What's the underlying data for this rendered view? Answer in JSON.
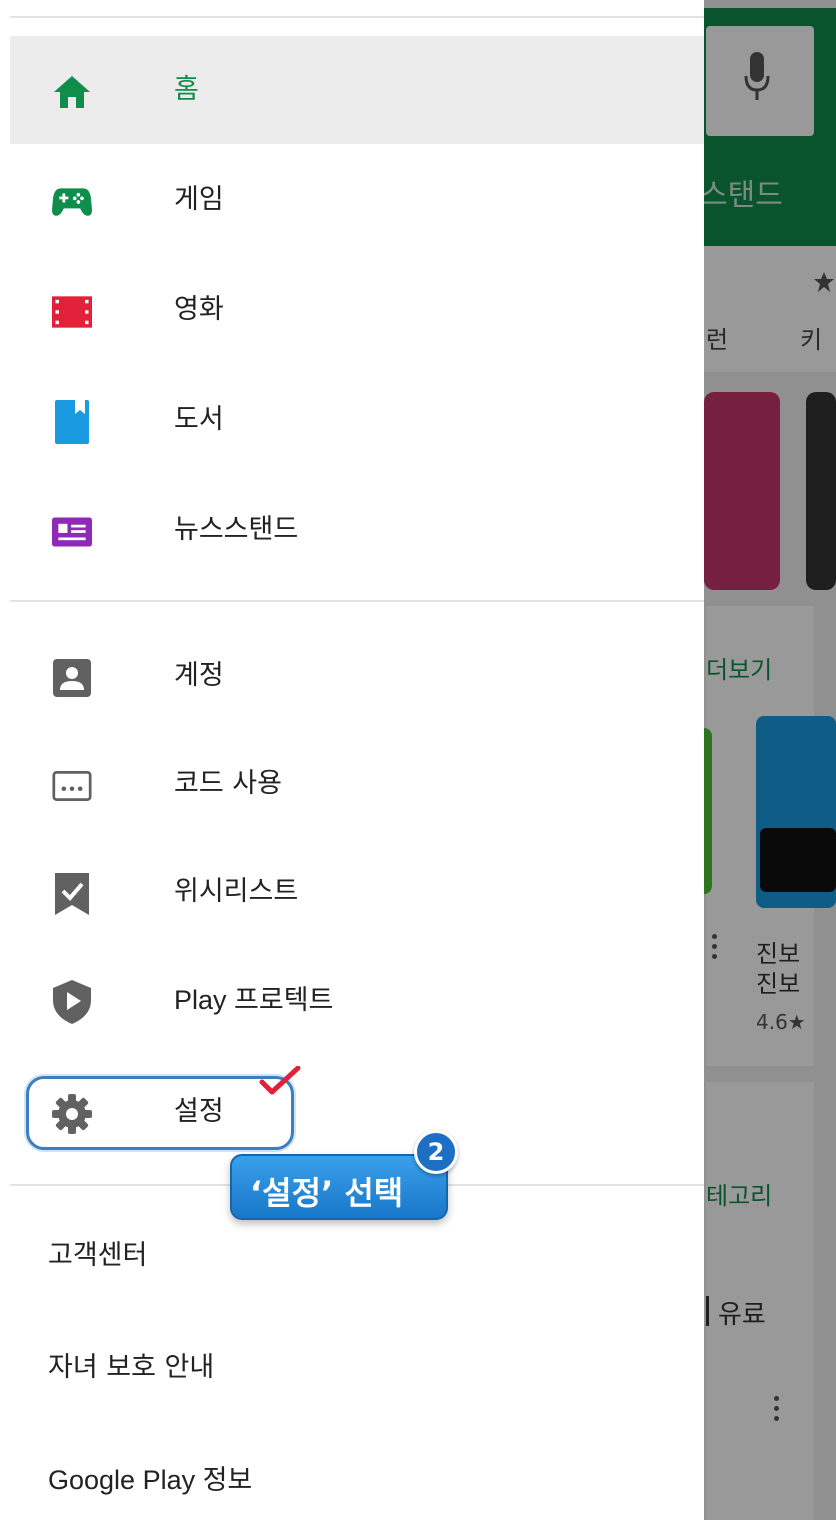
{
  "drawer": {
    "primary_items": [
      {
        "label": "홈",
        "icon": "home-icon",
        "active": true,
        "color": "#0f8d4a"
      },
      {
        "label": "게임",
        "icon": "gamepad-icon",
        "color": "#0f8d4a"
      },
      {
        "label": "영화",
        "icon": "film-icon",
        "color": "#e2203a"
      },
      {
        "label": "도서",
        "icon": "book-icon",
        "color": "#1a9ae0"
      },
      {
        "label": "뉴스스탠드",
        "icon": "newsstand-icon",
        "color": "#8e2ab5"
      }
    ],
    "secondary_items": [
      {
        "label": "계정",
        "icon": "account-icon"
      },
      {
        "label": "코드 사용",
        "icon": "redeem-code-icon"
      },
      {
        "label": "위시리스트",
        "icon": "wishlist-icon"
      },
      {
        "label": "Play 프로텍트",
        "icon": "shield-play-icon"
      },
      {
        "label": "설정",
        "icon": "gear-icon"
      }
    ],
    "footer_items": [
      {
        "label": "고객센터"
      },
      {
        "label": "자녀 보호 안내"
      },
      {
        "label": "Google Play 정보"
      }
    ]
  },
  "annotation": {
    "callout_text": "‘설정’ 선택",
    "step_number": "2",
    "highlight_color": "#3c7fc0"
  },
  "background": {
    "tab_text": "스탠드",
    "category_text_1": "런",
    "category_text_2": "키",
    "more_link": "더보기",
    "app_name_1": "진보",
    "app_name_2": "진보",
    "app_rating": "4.6★",
    "category_link": "테고리",
    "paid_text": "유료",
    "accent_color": "#0f8d4a"
  }
}
